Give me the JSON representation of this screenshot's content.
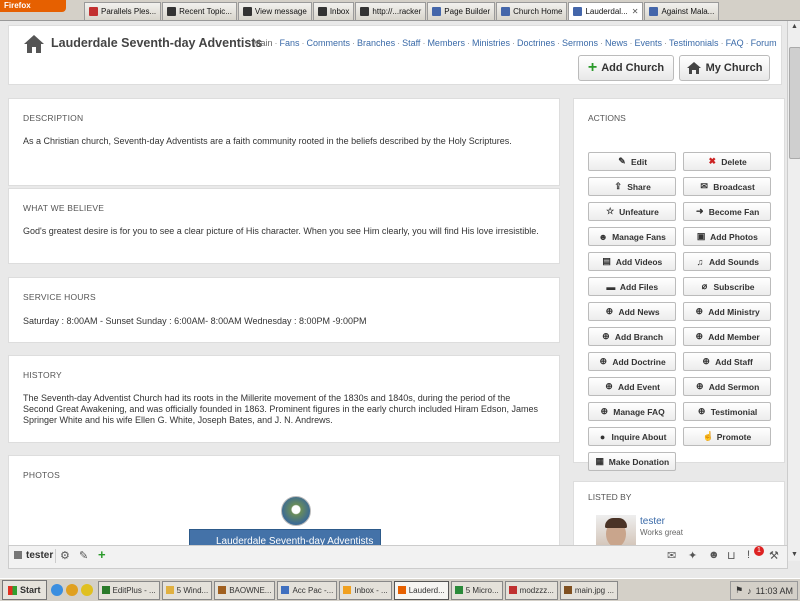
{
  "browser": {
    "app_button": "Firefox",
    "tabs": [
      {
        "label": "Parallels Ples...",
        "color": "#c23030",
        "active": false
      },
      {
        "label": "Recent Topic...",
        "color": "#333333",
        "active": false
      },
      {
        "label": "View message",
        "color": "#333333",
        "active": false
      },
      {
        "label": "Inbox",
        "color": "#333333",
        "active": false
      },
      {
        "label": "http://...racker",
        "color": "#333333",
        "active": false
      },
      {
        "label": "Page Builder",
        "color": "#4466aa",
        "active": false
      },
      {
        "label": "Church Home",
        "color": "#4466aa",
        "active": false
      },
      {
        "label": "Lauderdal...",
        "color": "#4466aa",
        "active": true
      },
      {
        "label": "Against Mala...",
        "color": "#4466aa",
        "active": false
      }
    ]
  },
  "header": {
    "title": "Lauderdale Seventh-day Adventists",
    "nav": [
      "Main",
      "Fans",
      "Comments",
      "Branches",
      "Staff",
      "Members",
      "Ministries",
      "Doctrines",
      "Sermons",
      "News",
      "Events",
      "Testimonials",
      "FAQ",
      "Forum"
    ],
    "add_church": "Add Church",
    "my_church": "My Church"
  },
  "sections": {
    "description": {
      "title": "DESCRIPTION",
      "body": "As a Christian church, Seventh-day Adventists are a faith community rooted in the beliefs described by the Holy Scriptures."
    },
    "beliefs": {
      "title": "WHAT WE BELIEVE",
      "body": "God's greatest desire is for you to see a clear picture of His character. When you see Him clearly, you will find His love irresistible."
    },
    "hours": {
      "title": "SERVICE HOURS",
      "body": "Saturday : 8:00AM - Sunset Sunday : 6:00AM- 8:00AM Wednesday : 8:00PM -9:00PM"
    },
    "history": {
      "title": "HISTORY",
      "body": "The Seventh-day Adventist Church had its roots in the Millerite movement of the 1830s and 1840s, during the period of the Second Great Awakening, and was officially founded in 1863. Prominent figures in the early church included Hiram Edson, James Springer White and his wife Ellen G. White, Joseph Bates, and J. N. Andrews."
    },
    "photos": {
      "title": "PHOTOS",
      "caption": "Lauderdale Seventh-day Adventists"
    }
  },
  "actions": {
    "title": "ACTIONS",
    "items": [
      {
        "label": "Edit",
        "icon": "✎",
        "name": "edit"
      },
      {
        "label": "Delete",
        "icon": "✖",
        "name": "delete"
      },
      {
        "label": "Share",
        "icon": "⇪",
        "name": "share"
      },
      {
        "label": "Broadcast",
        "icon": "✉",
        "name": "broadcast"
      },
      {
        "label": "Unfeature",
        "icon": "☆",
        "name": "unfeature"
      },
      {
        "label": "Become Fan",
        "icon": "➜",
        "name": "become-fan"
      },
      {
        "label": "Manage Fans",
        "icon": "☻",
        "name": "manage-fans"
      },
      {
        "label": "Add Photos",
        "icon": "▣",
        "name": "add-photos"
      },
      {
        "label": "Add Videos",
        "icon": "▤",
        "name": "add-videos"
      },
      {
        "label": "Add Sounds",
        "icon": "♫",
        "name": "add-sounds"
      },
      {
        "label": "Add Files",
        "icon": "▬",
        "name": "add-files"
      },
      {
        "label": "Subscribe",
        "icon": "⌀",
        "name": "subscribe"
      },
      {
        "label": "Add News",
        "icon": "⊕",
        "name": "add-news"
      },
      {
        "label": "Add Ministry",
        "icon": "⊕",
        "name": "add-ministry"
      },
      {
        "label": "Add Branch",
        "icon": "⊕",
        "name": "add-branch"
      },
      {
        "label": "Add Member",
        "icon": "⊕",
        "name": "add-member"
      },
      {
        "label": "Add Doctrine",
        "icon": "⊕",
        "name": "add-doctrine"
      },
      {
        "label": "Add Staff",
        "icon": "⊕",
        "name": "add-staff"
      },
      {
        "label": "Add Event",
        "icon": "⊕",
        "name": "add-event"
      },
      {
        "label": "Add Sermon",
        "icon": "⊕",
        "name": "add-sermon"
      },
      {
        "label": "Manage FAQ",
        "icon": "⊕",
        "name": "manage-faq"
      },
      {
        "label": "Testimonial",
        "icon": "⊕",
        "name": "testimonial"
      },
      {
        "label": "Inquire About",
        "icon": "●",
        "name": "inquire-about"
      },
      {
        "label": "Promote",
        "icon": "☝",
        "name": "promote"
      },
      {
        "label": "Make Donation",
        "icon": "▦",
        "name": "make-donation"
      }
    ]
  },
  "listed_by": {
    "title": "LISTED BY",
    "name": "tester",
    "status": "Works great"
  },
  "addon_bar": {
    "user": "tester",
    "notification_count": "1"
  },
  "taskbar": {
    "start": "Start",
    "tasks": [
      {
        "label": "EditPlus - ...",
        "color": "#2a7a2a",
        "active": false
      },
      {
        "label": "5 Wind...",
        "color": "#e0b040",
        "active": false
      },
      {
        "label": "BAOWNE...",
        "color": "#a06020",
        "active": false
      },
      {
        "label": "Acc Pac -...",
        "color": "#4070c0",
        "active": false
      },
      {
        "label": "Inbox - ...",
        "color": "#f0a020",
        "active": false
      },
      {
        "label": "Lauderd...",
        "color": "#e66000",
        "active": true
      },
      {
        "label": "5 Micro...",
        "color": "#2a8a3a",
        "active": false
      },
      {
        "label": "modzzz...",
        "color": "#c03030",
        "active": false
      },
      {
        "label": "main.jpg ...",
        "color": "#805020",
        "active": false
      }
    ],
    "clock": "11:03 AM"
  }
}
